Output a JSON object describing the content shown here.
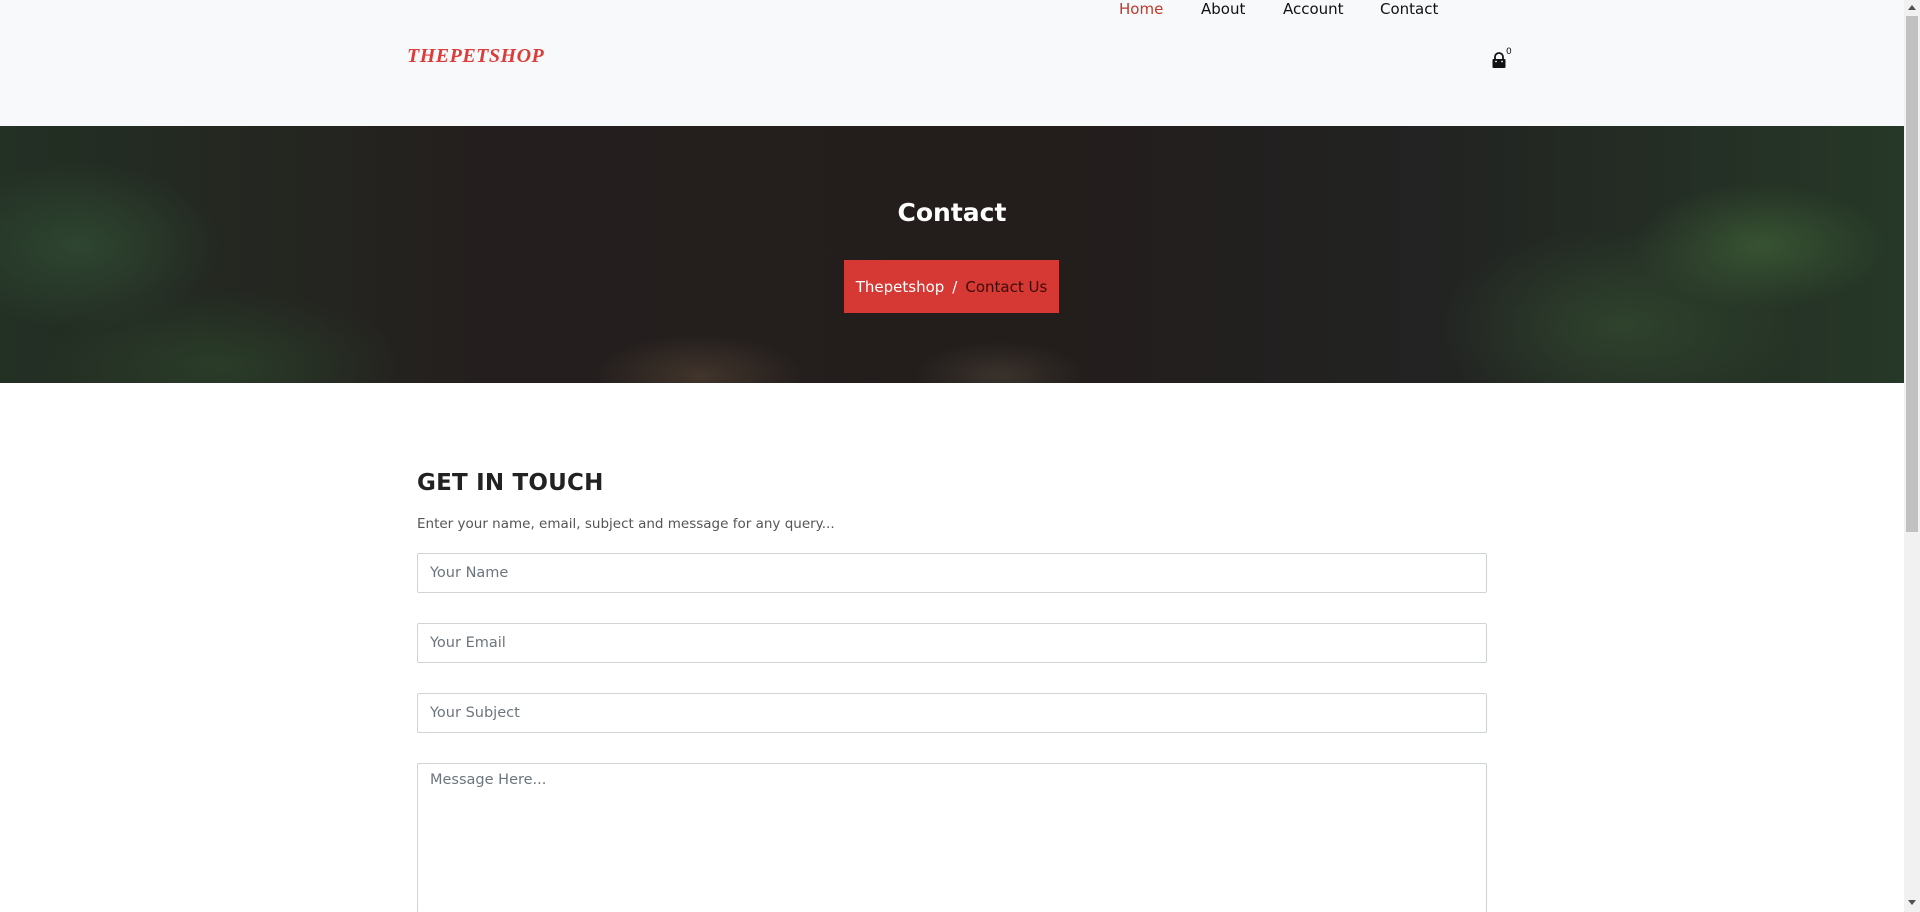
{
  "header": {
    "logo": "THEPETSHOP",
    "nav": [
      {
        "label": "Home",
        "active": true
      },
      {
        "label": "About",
        "active": false
      },
      {
        "label": "Account",
        "active": false
      },
      {
        "label": "Contact",
        "active": false
      }
    ],
    "cart": {
      "icon": "shopping-bag-icon",
      "count": "0"
    }
  },
  "hero": {
    "title": "Contact",
    "breadcrumb": {
      "home": "Thepetshop",
      "separator": "/",
      "current": "Contact Us"
    }
  },
  "contact": {
    "title": "GET IN TOUCH",
    "subtitle": "Enter your name, email, subject and message for any query...",
    "fields": {
      "name_placeholder": "Your Name",
      "email_placeholder": "Your Email",
      "subject_placeholder": "Your Subject",
      "message_placeholder": "Message Here..."
    }
  },
  "colors": {
    "accent": "#dc3d3b",
    "header_bg": "#f8f9fa"
  }
}
